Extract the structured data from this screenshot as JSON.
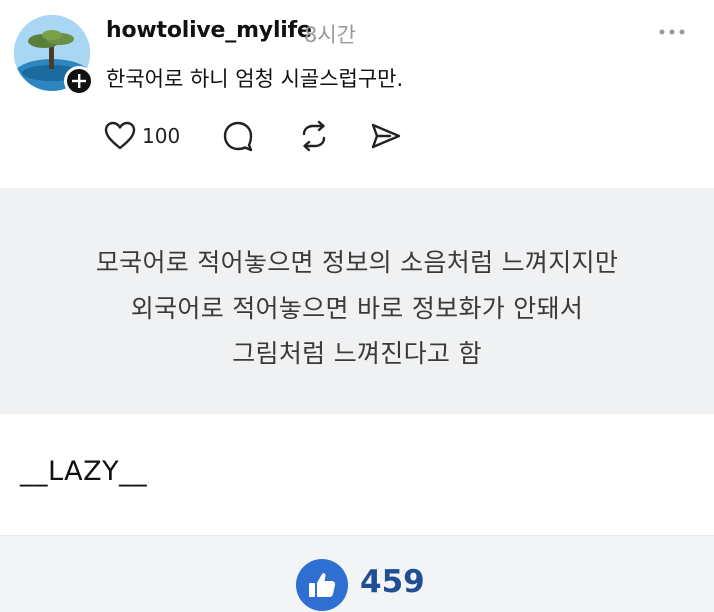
{
  "post": {
    "username": "howtolive_mylife",
    "timestamp": "8시간",
    "text": "한국어로 하니 엄청 시골스럽구만.",
    "like_count": "100"
  },
  "quote": {
    "lines": [
      "모국어로 적어놓으면 정보의 소음처럼 느껴지지만",
      "외국어로 적어놓으면 바로 정보화가 안돼서",
      "그림처럼 느껴진다고 함"
    ]
  },
  "author": "__LAZY__",
  "footer": {
    "vote_count": "459"
  },
  "colors": {
    "quote_bg": "#f0f1f3",
    "vote_blue": "#2f6fd1",
    "timestamp_gray": "#9a9a9a"
  },
  "icons": [
    "plus-icon",
    "more-icon",
    "heart-icon",
    "comment-icon",
    "repost-icon",
    "send-icon",
    "thumbs-up-icon"
  ]
}
